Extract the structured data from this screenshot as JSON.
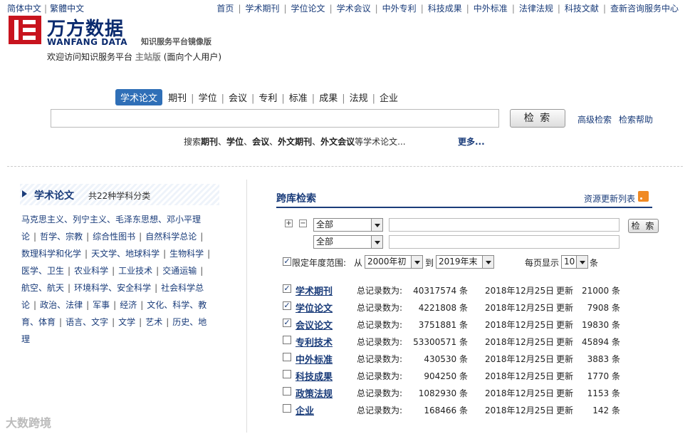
{
  "lang": {
    "simplified": "简体中文",
    "traditional": "繁體中文"
  },
  "topnav": [
    "首页",
    "学术期刊",
    "学位论文",
    "学术会议",
    "中外专利",
    "科技成果",
    "中外标准",
    "法律法规",
    "科技文献",
    "查新咨询服务中心"
  ],
  "logo": {
    "cn": "万方数据",
    "en": "WANFANG DATA",
    "sub": "知识服务平台镜像版"
  },
  "welcome": {
    "prefix": "欢迎访问知识服务平台",
    "version": "主站版",
    "suffix": "(面向个人用户)"
  },
  "tabs": [
    "学术论文",
    "期刊",
    "学位",
    "会议",
    "专利",
    "标准",
    "成果",
    "法规",
    "企业"
  ],
  "search": {
    "value": "",
    "button": "检 索",
    "advanced": "高级检索",
    "help": "检索帮助"
  },
  "hint": {
    "prefix": "搜索",
    "t1": "期刊",
    "t2": "学位",
    "t3": "会议",
    "t4": "外文期刊",
    "t5": "外文会议",
    "suffix": "等学术论文...",
    "more": "更多..."
  },
  "left": {
    "title": "学术论文",
    "count": "共22种学科分类",
    "subjects": [
      "马克思主义、列宁主义、毛泽东思想、邓小平理论",
      "哲学、宗教",
      "综合性图书",
      "自然科学总论",
      "数理科学和化学",
      "天文学、地球科学",
      "生物科学",
      "医学、卫生",
      "农业科学",
      "工业技术",
      "交通运输",
      "航空、航天",
      "环境科学、安全科学",
      "社会科学总论",
      "政治、法律",
      "军事",
      "经济",
      "文化、科学、教育、体育",
      "语言、文字",
      "文学",
      "艺术",
      "历史、地理"
    ]
  },
  "right": {
    "title": "跨库检索",
    "resource_list": "资源更新列表",
    "field1": "全部",
    "field2": "全部",
    "search_button": "检 索",
    "year_label": "限定年度范围:",
    "from": "从",
    "from_value": "2000年初",
    "to": "到",
    "to_value": "2019年末",
    "per_page_label": "每页显示",
    "per_page_value": "10",
    "per_page_unit": "条",
    "total_label": "总记录数为:",
    "unit": "条",
    "update_label": "更新",
    "databases": [
      {
        "name": "学术期刊",
        "checked": true,
        "count": "40317574",
        "date": "2018年12月25日",
        "update": "21000"
      },
      {
        "name": "学位论文",
        "checked": true,
        "count": "4221808",
        "date": "2018年12月25日",
        "update": "7908"
      },
      {
        "name": "会议论文",
        "checked": true,
        "count": "3751881",
        "date": "2018年12月25日",
        "update": "19830"
      },
      {
        "name": "专利技术",
        "checked": false,
        "count": "53300571",
        "date": "2018年12月25日",
        "update": "45894"
      },
      {
        "name": "中外标准",
        "checked": false,
        "count": "430530",
        "date": "2018年12月25日",
        "update": "3883"
      },
      {
        "name": "科技成果",
        "checked": false,
        "count": "904250",
        "date": "2018年12月25日",
        "update": "1770"
      },
      {
        "name": "政策法规",
        "checked": false,
        "count": "1082930",
        "date": "2018年12月25日",
        "update": "1153"
      },
      {
        "name": "企业",
        "checked": false,
        "count": "168466",
        "date": "2018年12月25日",
        "update": "142"
      }
    ]
  },
  "watermark": "大数跨境"
}
